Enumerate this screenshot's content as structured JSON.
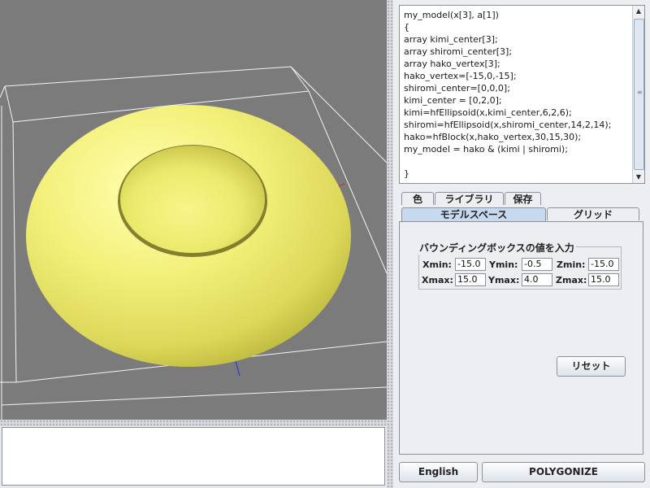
{
  "code_editor": {
    "text": "my_model(x[3], a[1])\n{\narray kimi_center[3];\narray shiromi_center[3];\narray hako_vertex[3];\nhako_vertex=[-15,0,-15];\nshiromi_center=[0,0,0];\nkimi_center = [0,2,0];\nkimi=hfEllipsoid(x,kimi_center,6,2,6);\nshiromi=hfEllipsoid(x,shiromi_center,14,2,14);\nhako=hfBlock(x,hako_vertex,30,15,30);\nmy_model = hako & (kimi | shiromi);\n\n}"
  },
  "tabs_top": [
    "色",
    "ライブラリ",
    "保存"
  ],
  "tabs_bottom": [
    "モデルスペース",
    "グリッド"
  ],
  "bounding_box": {
    "title": "バウンディングボックスの値を入力",
    "xmin_label": "Xmin:",
    "xmin": "-15.0",
    "ymin_label": "Ymin:",
    "ymin": "-0.5",
    "zmin_label": "Zmin:",
    "zmin": "-15.0",
    "xmax_label": "Xmax:",
    "xmax": "15.0",
    "ymax_label": "Ymax:",
    "ymax": "4.0",
    "zmax_label": "Zmax:",
    "zmax": "15.0"
  },
  "buttons": {
    "reset": "リセット",
    "english": "English",
    "polygonize": "POLYGONIZE"
  },
  "colors": {
    "viewport_bg": "#7b7b7b",
    "model_yellow": "#f2ef6e",
    "active_tab": "#c6d9ee"
  }
}
